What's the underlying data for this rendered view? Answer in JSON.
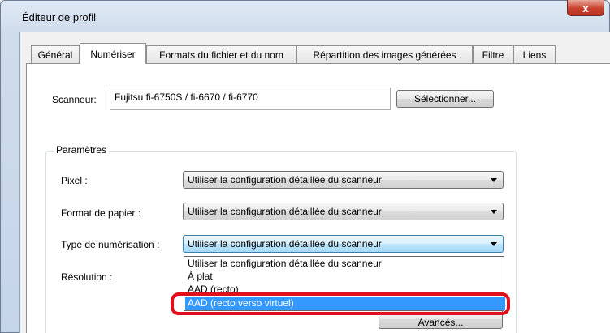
{
  "window": {
    "title": "Éditeur de profil",
    "close_glyph": "x"
  },
  "tabs": [
    {
      "label": "Général",
      "active": false
    },
    {
      "label": "Numériser",
      "active": true
    },
    {
      "label": "Formats du fichier et du nom",
      "active": false
    },
    {
      "label": "Répartition des images générées",
      "active": false
    },
    {
      "label": "Filtre",
      "active": false
    },
    {
      "label": "Liens",
      "active": false
    }
  ],
  "scanner": {
    "label": "Scanneur:",
    "value": "Fujitsu fi-6750S / fi-6670 / fi-6770",
    "select_button": "Sélectionner..."
  },
  "params": {
    "group_title": "Paramètres",
    "pixel": {
      "label": "Pixel :",
      "value": "Utiliser la configuration détaillée du scanneur"
    },
    "paper_format": {
      "label": "Format de papier :",
      "value": "Utiliser la configuration détaillée du scanneur"
    },
    "scan_type": {
      "label": "Type de numérisation :",
      "value": "Utiliser la configuration détaillée du scanneur"
    },
    "resolution": {
      "label": "Résolution :"
    }
  },
  "dropdown": {
    "options": [
      "Utiliser la configuration détaillée du scanneur",
      "À plat",
      "AAD (recto)",
      "AAD (recto verso virtuel)"
    ],
    "selected_index": 3
  },
  "advanced_button": "Avancés...",
  "colors": {
    "selection": "#3399ff",
    "highlight_ring": "#e0101a"
  }
}
